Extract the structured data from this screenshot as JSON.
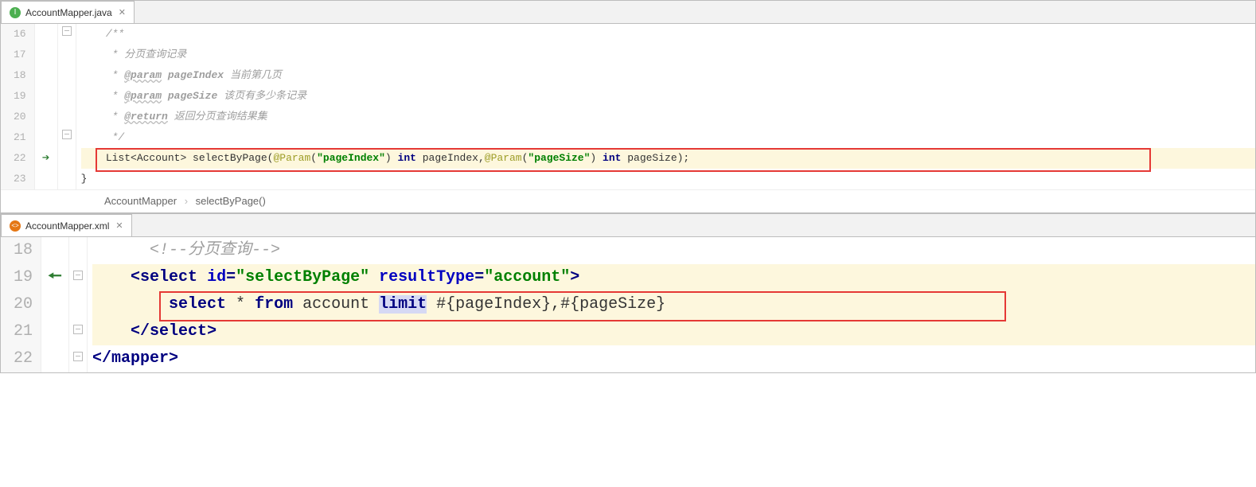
{
  "java": {
    "tab_label": "AccountMapper.java",
    "gutter": [
      "16",
      "17",
      "18",
      "19",
      "20",
      "21",
      "22",
      "23"
    ],
    "code": {
      "l16": "/**",
      "l17_a": " * ",
      "l17_b": "分页查询记录",
      "l18_a": " * ",
      "l18_tag": "@param",
      "l18_name": " pageIndex",
      "l18_b": " 当前第几页",
      "l19_a": " * ",
      "l19_tag": "@param",
      "l19_name": " pageSize",
      "l19_b": " 该页有多少条记录",
      "l20_a": " * ",
      "l20_tag": "@return",
      "l20_b": " 返回分页查询结果集",
      "l21": " */",
      "l22_a": "List<Account> selectByPage(",
      "l22_ann1": "@Param",
      "l22_p1o": "(",
      "l22_s1": "\"pageIndex\"",
      "l22_p1c": ") ",
      "l22_kw1": "int",
      "l22_id1": " pageIndex,",
      "l22_ann2": "@Param",
      "l22_p2o": "(",
      "l22_s2": "\"pageSize\"",
      "l22_p2c": ") ",
      "l22_kw2": "int",
      "l22_id2": " pageSize);",
      "l23": "}"
    },
    "breadcrumb": {
      "a": "AccountMapper",
      "b": "selectByPage()"
    }
  },
  "xml": {
    "tab_label": "AccountMapper.xml",
    "gutter": [
      "18",
      "19",
      "20",
      "21",
      "22"
    ],
    "code": {
      "l18_a": "<!--",
      "l18_b": "分页查询",
      "l18_c": "-->",
      "l19_open": "<",
      "l19_tag": "select",
      "l19_sp": " ",
      "l19_a1": "id",
      "l19_eq1": "=",
      "l19_v1": "\"selectByPage\"",
      "l19_sp2": " ",
      "l19_a2": "resultType",
      "l19_eq2": "=",
      "l19_v2": "\"account\"",
      "l19_close": ">",
      "l20_kw1": "select",
      "l20_mid": " * ",
      "l20_kw2": "from",
      "l20_tbl": " account ",
      "l20_kw3": "limit",
      "l20_args": " #{pageIndex},#{pageSize}",
      "l21": "</",
      "l21_tag": "select",
      "l21_c": ">",
      "l22": "</",
      "l22_tag": "mapper",
      "l22_c": ">"
    }
  }
}
